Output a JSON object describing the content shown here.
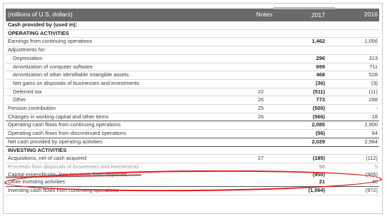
{
  "header": {
    "label": "(millions of U.S. dollars)",
    "notes": "Notes",
    "year_1": "2017",
    "year_2": "2016"
  },
  "rows": [
    {
      "label": "Cash provided by (used in):",
      "notes": "",
      "v2017": "",
      "v2016": ""
    },
    {
      "label": "OPERATING ACTIVITIES",
      "notes": "",
      "v2017": "",
      "v2016": ""
    },
    {
      "label": "Earnings from continuing operations",
      "notes": "",
      "v2017": "1,462",
      "v2016": "1,056"
    },
    {
      "label": "Adjustments for:",
      "notes": "",
      "v2017": "",
      "v2016": ""
    },
    {
      "label": "Depreciation",
      "notes": "",
      "v2017": "296",
      "v2016": "313"
    },
    {
      "label": "Amortization of computer software",
      "notes": "",
      "v2017": "699",
      "v2016": "711"
    },
    {
      "label": "Amortization of other identifiable intangible assets",
      "notes": "",
      "v2017": "468",
      "v2016": "528"
    },
    {
      "label": "Net gains on disposals of businesses and investments",
      "notes": "",
      "v2017": "(36)",
      "v2016": "(3)"
    },
    {
      "label": "Deferred tax",
      "notes": "22",
      "v2017": "(511)",
      "v2016": "(11)"
    },
    {
      "label": "Other",
      "notes": "26",
      "v2017": "773",
      "v2016": "288"
    },
    {
      "label": "Pension contribution",
      "notes": "25",
      "v2017": "(500)",
      "v2016": "-"
    },
    {
      "label": "Changes in working capital and other items",
      "notes": "26",
      "v2017": "(566)",
      "v2016": "18"
    },
    {
      "label": "Operating cash flows from continuing operations",
      "notes": "",
      "v2017": "2,085",
      "v2016": "2,900"
    },
    {
      "label": "Operating cash flows from discontinued operations",
      "notes": "",
      "v2017": "(56)",
      "v2016": "84"
    },
    {
      "label": "Net cash provided by operating activities",
      "notes": "",
      "v2017": "2,029",
      "v2016": "2,984"
    },
    {
      "label": "INVESTING ACTIVITIES",
      "notes": "",
      "v2017": "",
      "v2016": ""
    },
    {
      "label": "Acquisitions, net of cash acquired",
      "notes": "27",
      "v2017": "(185)",
      "v2016": "(112)"
    },
    {
      "label": "Proceeds from disposals of businesses and investments",
      "notes": "",
      "v2017": "50",
      "v2016": "5"
    },
    {
      "label": "Capital expenditures, less proceeds from disposals",
      "notes": "",
      "v2017": "(950)",
      "v2016": "(905)"
    },
    {
      "label": "Other investing activities",
      "notes": "",
      "v2017": "21",
      "v2016": "40"
    },
    {
      "label": "Investing cash flows from continuing operations",
      "notes": "",
      "v2017": "(1,064)",
      "v2016": "(972)"
    }
  ],
  "annotation": {
    "color": "#e21a1a",
    "highlighted_row": "Capital expenditures, less proceeds from disposals"
  }
}
